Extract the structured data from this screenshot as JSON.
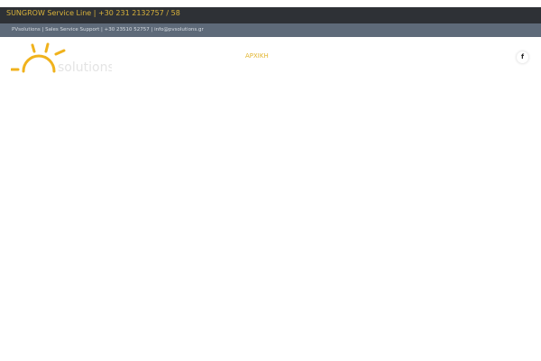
{
  "service_bar": {
    "text": "SUNGROW Service Line | +30 231 2132757 / 58"
  },
  "contact_bar": {
    "text": "PVsolutions | Sales Service Support | +30 23510 52757 | info@pvsolutions.gr"
  },
  "logo": {
    "text": "pvsolutions"
  },
  "nav": {
    "home": "ΑΡΧΙΚΗ"
  },
  "social": {
    "facebook_glyph": "f"
  },
  "colors": {
    "accent": "#e2b52e",
    "service_bar": "#2e3136",
    "contact_bar": "#5e6a79"
  }
}
